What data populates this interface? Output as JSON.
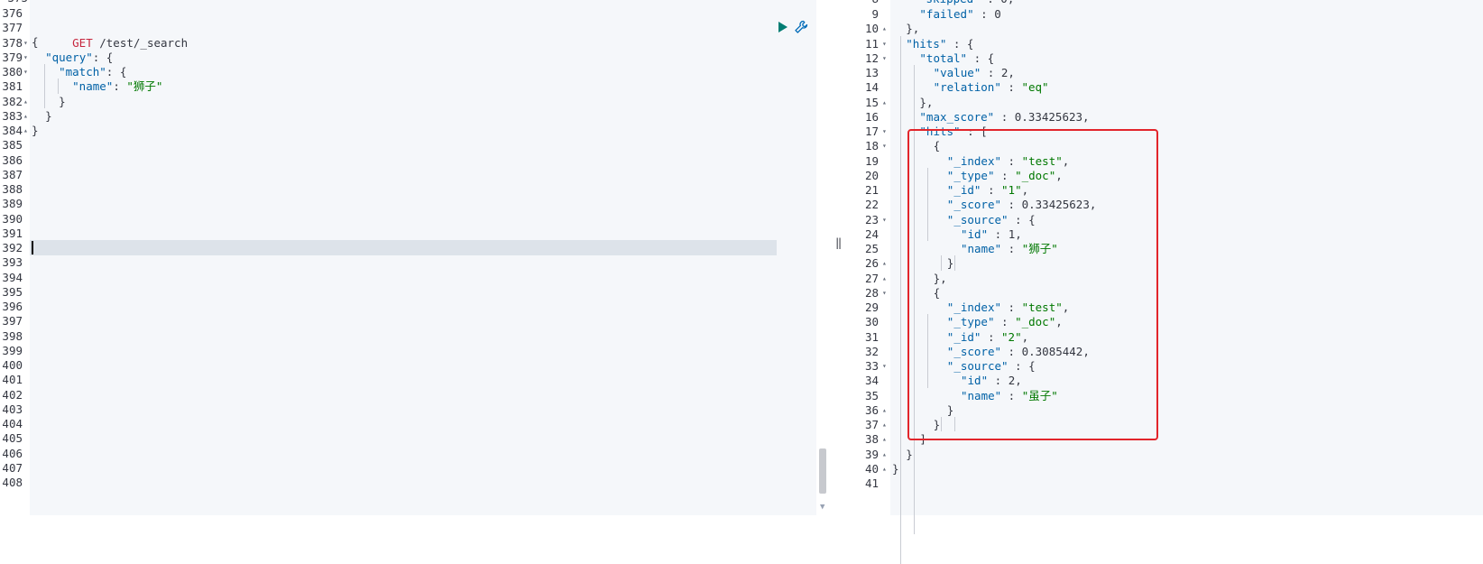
{
  "request_editor": {
    "gutter": [
      "376",
      "377",
      "378",
      "379",
      "380",
      "381",
      "382",
      "383",
      "384",
      "385",
      "386",
      "387",
      "388",
      "389",
      "390",
      "391",
      "392",
      "393",
      "394",
      "395",
      "396",
      "397",
      "398",
      "399",
      "400",
      "401",
      "402",
      "403",
      "404",
      "405",
      "406",
      "407",
      "408"
    ],
    "top_partial_line": "375",
    "request_line": {
      "method": "GET",
      "url": " /test/_search"
    },
    "body": [
      {
        "text": "{"
      },
      {
        "text": "  \"query\": {",
        "key": "\"query\""
      },
      {
        "text": "    \"match\": {",
        "key": "\"match\""
      },
      {
        "text": "      \"name\": \"狮子\"",
        "key": "\"name\"",
        "value": "\"狮子\""
      },
      {
        "text": "    }"
      },
      {
        "text": "  }"
      },
      {
        "text": "}"
      }
    ],
    "tokens": {
      "open_brace": "{",
      "close_brace": "}",
      "query_key": "\"query\"",
      "match_key": "\"match\"",
      "name_key": "\"name\"",
      "colon_open": ": {",
      "colon": ": ",
      "name_value": "\"狮子\""
    }
  },
  "response_editor": {
    "top_partial": {
      "num": "8",
      "text": "\"skipped\" : 0,"
    },
    "lines": [
      {
        "num": "9",
        "indent": 4,
        "parts": [
          [
            "k",
            "\"failed\""
          ],
          [
            "p",
            " : "
          ],
          [
            "n",
            "0"
          ]
        ]
      },
      {
        "num": "10",
        "indent": 2,
        "parts": [
          [
            "p",
            "},"
          ]
        ]
      },
      {
        "num": "11",
        "indent": 2,
        "parts": [
          [
            "k",
            "\"hits\""
          ],
          [
            "p",
            " : {"
          ]
        ]
      },
      {
        "num": "12",
        "indent": 4,
        "parts": [
          [
            "k",
            "\"total\""
          ],
          [
            "p",
            " : {"
          ]
        ]
      },
      {
        "num": "13",
        "indent": 6,
        "parts": [
          [
            "k",
            "\"value\""
          ],
          [
            "p",
            " : "
          ],
          [
            "n",
            "2"
          ],
          [
            "p",
            ","
          ]
        ]
      },
      {
        "num": "14",
        "indent": 6,
        "parts": [
          [
            "k",
            "\"relation\""
          ],
          [
            "p",
            " : "
          ],
          [
            "s",
            "\"eq\""
          ]
        ]
      },
      {
        "num": "15",
        "indent": 4,
        "parts": [
          [
            "p",
            "},"
          ]
        ]
      },
      {
        "num": "16",
        "indent": 4,
        "parts": [
          [
            "k",
            "\"max_score\""
          ],
          [
            "p",
            " : "
          ],
          [
            "n",
            "0.33425623"
          ],
          [
            "p",
            ","
          ]
        ]
      },
      {
        "num": "17",
        "indent": 4,
        "parts": [
          [
            "k",
            "\"hits\""
          ],
          [
            "p",
            " : ["
          ]
        ]
      },
      {
        "num": "18",
        "indent": 6,
        "parts": [
          [
            "p",
            "{"
          ]
        ]
      },
      {
        "num": "19",
        "indent": 8,
        "parts": [
          [
            "k",
            "\"_index\""
          ],
          [
            "p",
            " : "
          ],
          [
            "s",
            "\"test\""
          ],
          [
            "p",
            ","
          ]
        ]
      },
      {
        "num": "20",
        "indent": 8,
        "parts": [
          [
            "k",
            "\"_type\""
          ],
          [
            "p",
            " : "
          ],
          [
            "s",
            "\"_doc\""
          ],
          [
            "p",
            ","
          ]
        ]
      },
      {
        "num": "21",
        "indent": 8,
        "parts": [
          [
            "k",
            "\"_id\""
          ],
          [
            "p",
            " : "
          ],
          [
            "s",
            "\"1\""
          ],
          [
            "p",
            ","
          ]
        ]
      },
      {
        "num": "22",
        "indent": 8,
        "parts": [
          [
            "k",
            "\"_score\""
          ],
          [
            "p",
            " : "
          ],
          [
            "n",
            "0.33425623"
          ],
          [
            "p",
            ","
          ]
        ]
      },
      {
        "num": "23",
        "indent": 8,
        "parts": [
          [
            "k",
            "\"_source\""
          ],
          [
            "p",
            " : {"
          ]
        ]
      },
      {
        "num": "24",
        "indent": 10,
        "parts": [
          [
            "k",
            "\"id\""
          ],
          [
            "p",
            " : "
          ],
          [
            "n",
            "1"
          ],
          [
            "p",
            ","
          ]
        ]
      },
      {
        "num": "25",
        "indent": 10,
        "parts": [
          [
            "k",
            "\"name\""
          ],
          [
            "p",
            " : "
          ],
          [
            "s",
            "\"狮子\""
          ]
        ]
      },
      {
        "num": "26",
        "indent": 8,
        "parts": [
          [
            "p",
            "}"
          ]
        ]
      },
      {
        "num": "27",
        "indent": 6,
        "parts": [
          [
            "p",
            "},"
          ]
        ]
      },
      {
        "num": "28",
        "indent": 6,
        "parts": [
          [
            "p",
            "{"
          ]
        ]
      },
      {
        "num": "29",
        "indent": 8,
        "parts": [
          [
            "k",
            "\"_index\""
          ],
          [
            "p",
            " : "
          ],
          [
            "s",
            "\"test\""
          ],
          [
            "p",
            ","
          ]
        ]
      },
      {
        "num": "30",
        "indent": 8,
        "parts": [
          [
            "k",
            "\"_type\""
          ],
          [
            "p",
            " : "
          ],
          [
            "s",
            "\"_doc\""
          ],
          [
            "p",
            ","
          ]
        ]
      },
      {
        "num": "31",
        "indent": 8,
        "parts": [
          [
            "k",
            "\"_id\""
          ],
          [
            "p",
            " : "
          ],
          [
            "s",
            "\"2\""
          ],
          [
            "p",
            ","
          ]
        ]
      },
      {
        "num": "32",
        "indent": 8,
        "parts": [
          [
            "k",
            "\"_score\""
          ],
          [
            "p",
            " : "
          ],
          [
            "n",
            "0.3085442"
          ],
          [
            "p",
            ","
          ]
        ]
      },
      {
        "num": "33",
        "indent": 8,
        "parts": [
          [
            "k",
            "\"_source\""
          ],
          [
            "p",
            " : {"
          ]
        ]
      },
      {
        "num": "34",
        "indent": 10,
        "parts": [
          [
            "k",
            "\"id\""
          ],
          [
            "p",
            " : "
          ],
          [
            "n",
            "2"
          ],
          [
            "p",
            ","
          ]
        ]
      },
      {
        "num": "35",
        "indent": 10,
        "parts": [
          [
            "k",
            "\"name\""
          ],
          [
            "p",
            " : "
          ],
          [
            "s",
            "\"虽子\""
          ]
        ]
      },
      {
        "num": "36",
        "indent": 8,
        "parts": [
          [
            "p",
            "}"
          ]
        ]
      },
      {
        "num": "37",
        "indent": 6,
        "parts": [
          [
            "p",
            "}"
          ]
        ]
      },
      {
        "num": "38",
        "indent": 4,
        "parts": [
          [
            "p",
            "]"
          ]
        ]
      },
      {
        "num": "39",
        "indent": 2,
        "parts": [
          [
            "p",
            "}"
          ]
        ]
      },
      {
        "num": "40",
        "indent": 0,
        "parts": [
          [
            "p",
            "}"
          ]
        ]
      },
      {
        "num": "41",
        "indent": 0,
        "parts": []
      }
    ],
    "fold_lines": [
      "10",
      "11",
      "12",
      "15",
      "17",
      "18",
      "23",
      "26",
      "27",
      "28",
      "33",
      "36",
      "37",
      "38",
      "39",
      "40"
    ],
    "fold_open": [
      "11",
      "12",
      "17",
      "18",
      "23",
      "28",
      "33"
    ],
    "fold_close": [
      "10",
      "15",
      "26",
      "27",
      "36",
      "37",
      "38",
      "39",
      "40"
    ]
  },
  "colors": {
    "method": "#c6263e",
    "key": "#0061a6",
    "string": "#007800",
    "highlight_border": "#e2252b",
    "active_line": "#dde3ea",
    "run_button": "#017d73"
  },
  "icons": {
    "run": "play-icon",
    "settings": "wrench-icon",
    "resizer": "pane-resizer-icon"
  },
  "resizer_glyph": "‖"
}
